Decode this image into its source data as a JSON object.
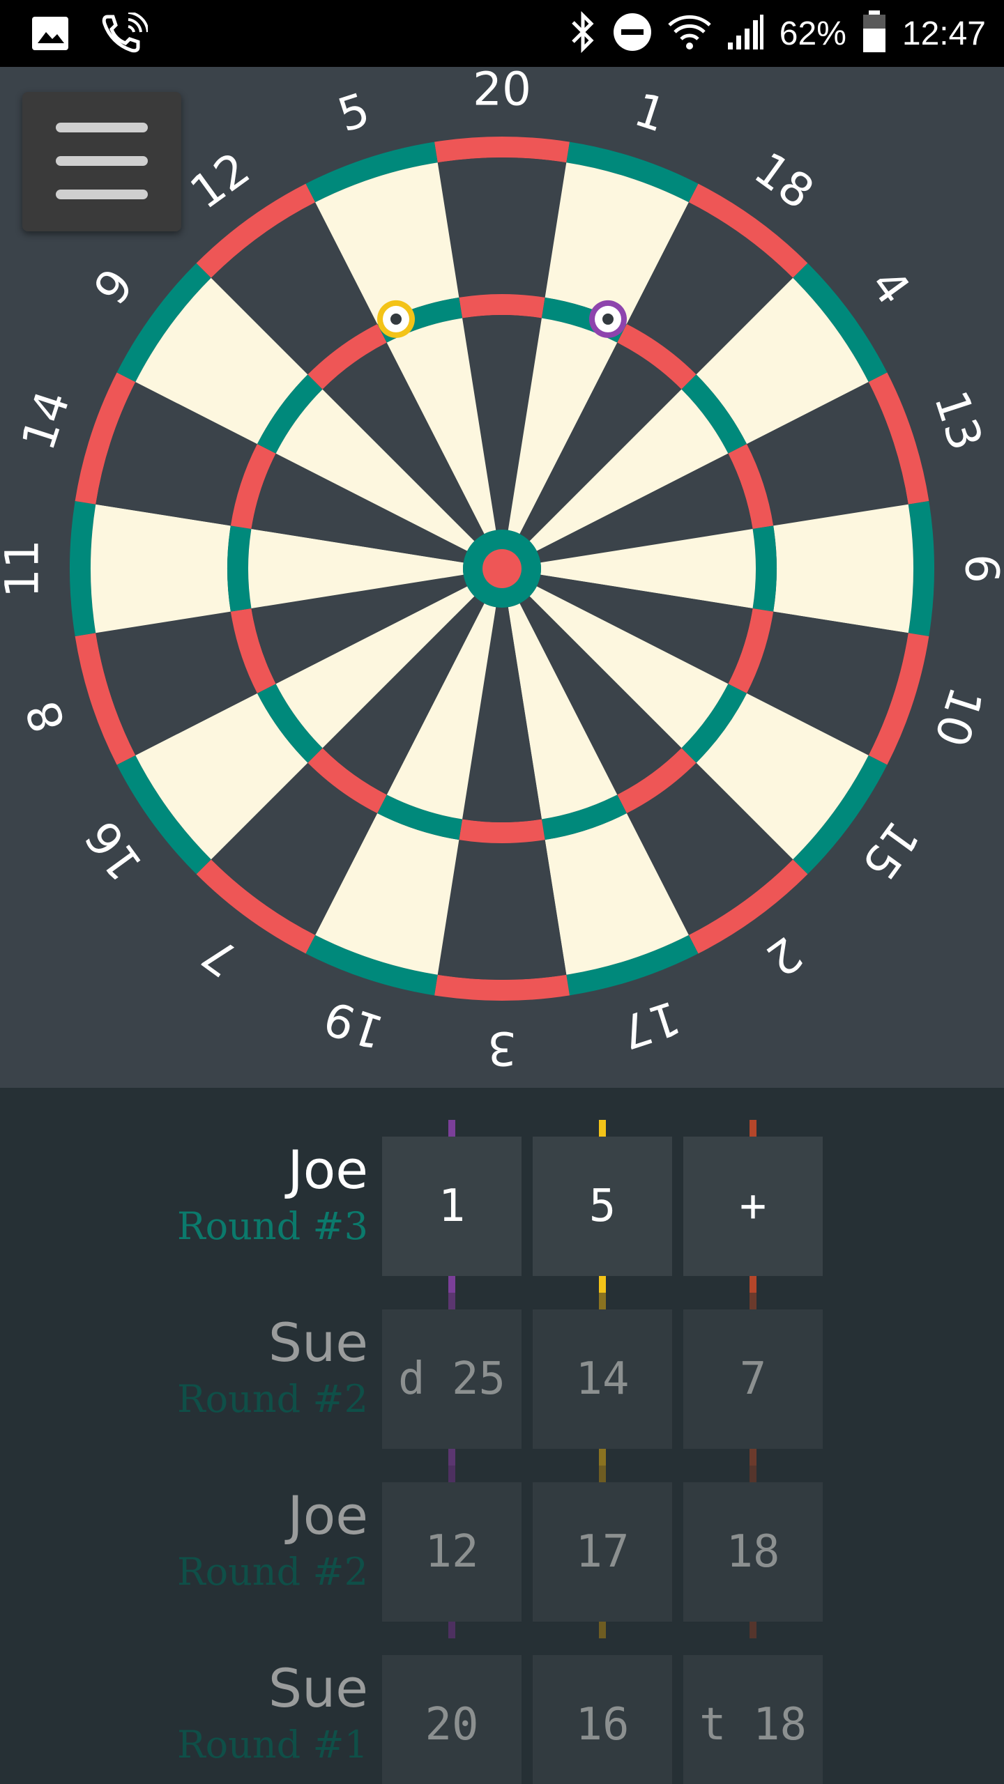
{
  "status_bar": {
    "battery": "62%",
    "time": "12:47",
    "icons": [
      "image-icon",
      "wifi-calling-icon",
      "bluetooth-icon",
      "do-not-disturb-icon",
      "wifi-icon",
      "signal-icon",
      "battery-icon"
    ]
  },
  "menu": {
    "icon": "hamburger-menu-icon"
  },
  "dartboard": {
    "numbers": [
      20,
      1,
      18,
      4,
      13,
      6,
      10,
      15,
      2,
      17,
      3,
      19,
      7,
      16,
      8,
      11,
      14,
      9,
      12,
      5
    ],
    "colors": {
      "light_segment": "#fdf7df",
      "dark_segment": "#3b434a",
      "red": "#ee5656",
      "green": "#00897b",
      "number_text": "#ffffff"
    },
    "dart_markers": [
      {
        "color": "#f3c318",
        "segment": 5,
        "ring": "triple"
      },
      {
        "color": "#8e44ad",
        "segment": 1,
        "ring": "triple"
      }
    ]
  },
  "throw_colors": [
    "#7b3f99",
    "#f3c318",
    "#b5462a"
  ],
  "rounds": [
    {
      "player": "Joe",
      "round": "Round #3",
      "current": true,
      "throws": [
        "1",
        "5",
        "+"
      ]
    },
    {
      "player": "Sue",
      "round": "Round #2",
      "current": false,
      "throws": [
        "d 25",
        "14",
        "7"
      ]
    },
    {
      "player": "Joe",
      "round": "Round #2",
      "current": false,
      "throws": [
        "12",
        "17",
        "18"
      ]
    },
    {
      "player": "Sue",
      "round": "Round #1",
      "current": false,
      "throws": [
        "20",
        "16",
        "t 18"
      ]
    }
  ]
}
